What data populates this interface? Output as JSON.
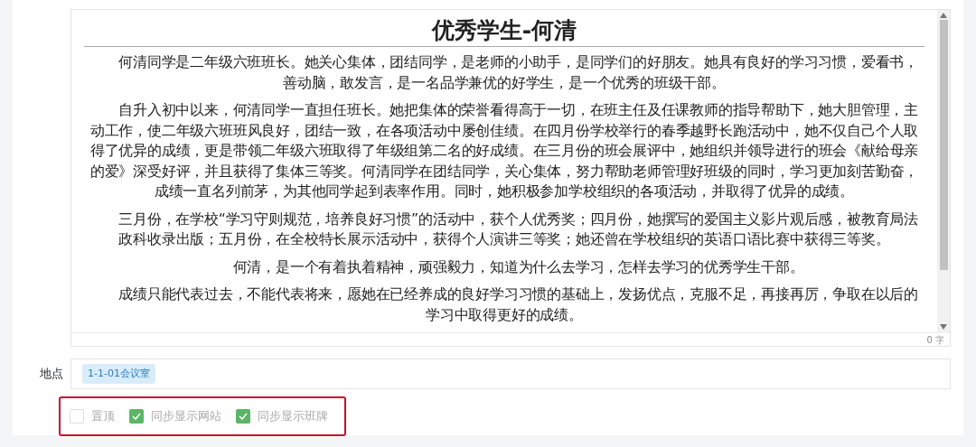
{
  "editor": {
    "title": "优秀学生-何清",
    "paragraphs": [
      "何清同学是二年级六班班长。她关心集体，团结同学，是老师的小助手，是同学们的好朋友。她具有良好的学习习惯，爱看书，善动脑，敢发言，是一名品学兼优的好学生，是一个优秀的班级干部。",
      "自升入初中以来，何清同学一直担任班长。她把集体的荣誉看得高于一切，在班主任及任课教师的指导帮助下，她大胆管理，主动工作，使二年级六班班风良好，团结一致，在各项活动中屡创佳绩。在四月份学校举行的春季越野长跑活动中，她不仅自己个人取得了优异的成绩，更是带领二年级六班取得了年级组第二名的好成绩。在三月份的班会展评中，她组织并领导进行的班会《献给母亲的爱》深受好评，并且获得了集体三等奖。何清同学在团结同学，关心集体，努力帮助老师管理好班级的同时，学习更加刻苦勤奋，成绩一直名列前茅，为其他同学起到表率作用。同时，她积极参加学校组织的各项活动，并取得了优异的成绩。",
      "三月份，在学校“学习守则规范，培养良好习惯”的活动中，获个人优秀奖；四月份，她撰写的爱国主义影片观后感，被教育局法政科收录出版；五月份，在全校特长展示活动中，获得个人演讲三等奖；她还曾在学校组织的英语口语比赛中获得三等奖。",
      "何清，是一个有着执着精神，顽强毅力，知道为什么去学习，怎样去学习的优秀学生干部。",
      "成绩只能代表过去，不能代表将来，愿她在已经养成的良好学习习惯的基础上，发扬优点，克服不足，再接再厉，争取在以后的学习中取得更好的成绩。"
    ],
    "word_count": "0 字"
  },
  "location": {
    "label": "地点",
    "tag": "1-1-01会议室"
  },
  "options": [
    {
      "label": "置顶",
      "checked": false
    },
    {
      "label": "同步显示网站",
      "checked": true
    },
    {
      "label": "同步显示班牌",
      "checked": true
    }
  ]
}
